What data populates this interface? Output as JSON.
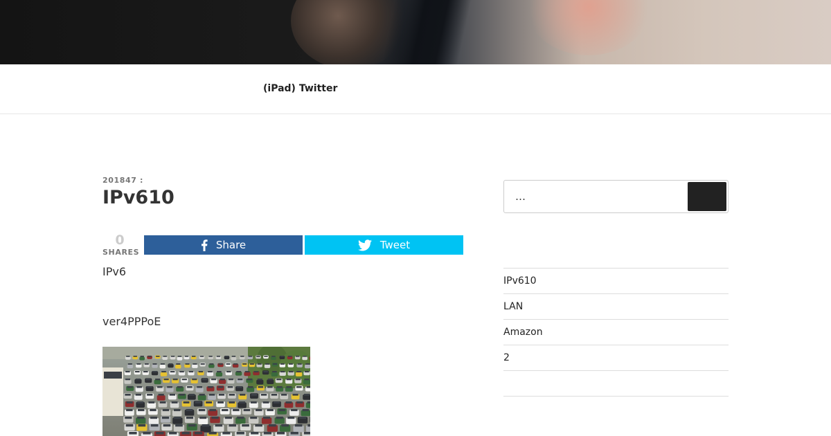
{
  "nav": {
    "items": [
      {
        "label": "(iPad) Twitter"
      }
    ]
  },
  "post": {
    "meta": "201847 :",
    "title": "IPv610",
    "share_count": "0",
    "share_count_label": "SHARES",
    "facebook_label": "Share",
    "twitter_label": "Tweet",
    "paragraphs": [
      "IPv6",
      "ver4PPPoE"
    ]
  },
  "sidebar": {
    "search": {
      "placeholder": "…"
    },
    "recent_posts": [
      "IPv610",
      "LAN",
      "Amazon",
      "2",
      ""
    ]
  },
  "colors": {
    "facebook": "#2d5f9a",
    "twitter": "#00c3f3",
    "search_button": "#222222"
  },
  "icons": [
    "facebook-icon",
    "twitter-icon"
  ]
}
